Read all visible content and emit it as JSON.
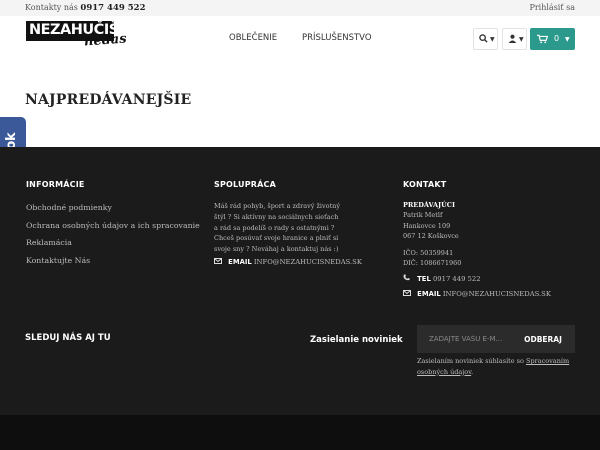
{
  "topbar": {
    "contact_label": "Kontakty nás",
    "phone": "0917 449 522",
    "login": "Prihlásiť sa"
  },
  "header": {
    "logo_text": "NEZAHUČIŠ",
    "logo_script": "nedas",
    "nav": [
      "OBLEČENIE",
      "PRÍSLUŠENSTVO"
    ],
    "cart_count": "0",
    "accent_color": "#2b9a8c"
  },
  "main": {
    "title": "NAJPREDÁVANEJŠIE"
  },
  "facebook_tab": {
    "label": "facebook",
    "color": "#3b5998"
  },
  "footer": {
    "info": {
      "heading": "INFORMÁCIE",
      "links": [
        "Obchodné podmienky",
        "Ochrana osobných údajov a ich spracovanie",
        "Reklamácia",
        "Kontaktujte Nás"
      ]
    },
    "cooperation": {
      "heading": "SPOLUPRÁCA",
      "text_lines": [
        "Máš rád pohyb, šport a zdravý životný",
        "štýl ? Si aktívny na sociálnych sieťach",
        "a rád sa podelíš o rady s ostatnými ?",
        "Chceš posúvať svoje hranice a plniť si",
        "svoje sny ? Neváhaj a kontaktuj nás :)"
      ],
      "email_label": "EMAIL",
      "email": "INFO@NEZAHUCISNEDAS.SK"
    },
    "contact": {
      "heading": "KONTAKT",
      "company_name": "PREDÁVAJÚCI",
      "person": "Patrik Metlf",
      "street": "Hankovce 109",
      "city": "067 12 Koškovce",
      "ico": "IČO: 50359941",
      "dic": "DIČ: 1086671960",
      "tel_label": "TEL",
      "tel": "0917 449 522",
      "email_label": "EMAIL",
      "email": "INFO@NEZAHUCISNEDAS.SK"
    },
    "follow": "SLEDUJ NÁS AJ TU",
    "newsletter": {
      "label": "Zasielanie noviniek",
      "placeholder": "ZADAJTE VAŠU E-M...",
      "button": "ODBERAJ",
      "note_text": "Zasielaním noviniek súhlasíte so ",
      "note_link": "Spracovaním osobných údajov",
      "note_end": "."
    }
  }
}
